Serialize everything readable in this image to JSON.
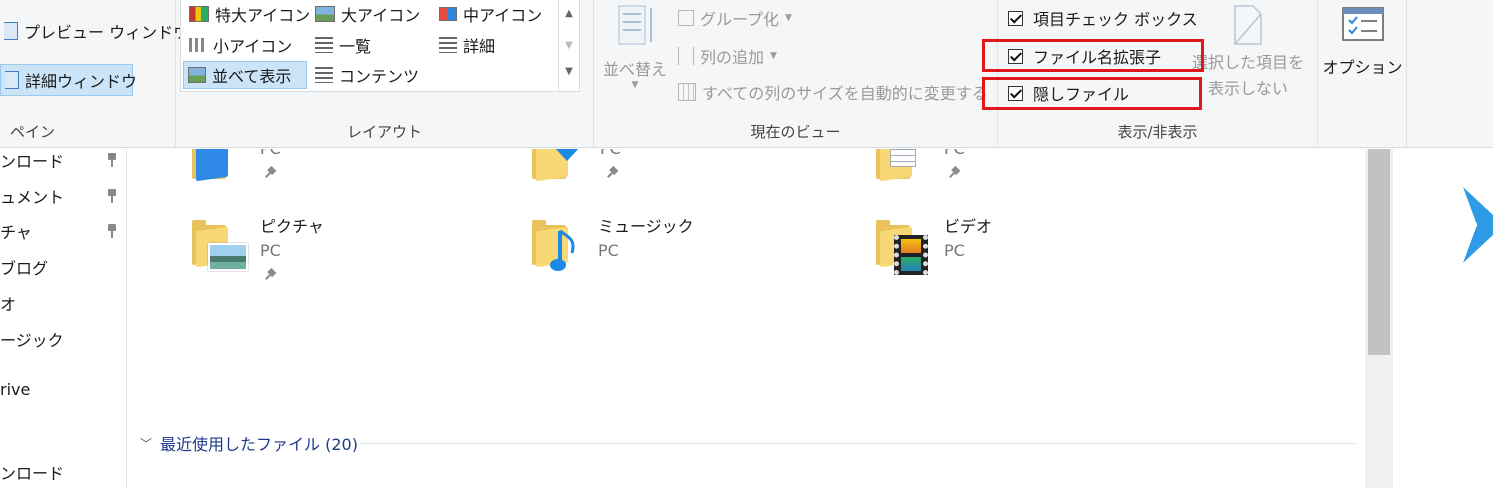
{
  "ribbon": {
    "pane": {
      "label": "ペイン",
      "preview_window": "プレビュー ウィンドウ",
      "details_window": "詳細ウィンドウ"
    },
    "layout": {
      "label": "レイアウト",
      "items": {
        "extra_large": "特大アイコン",
        "large": "大アイコン",
        "medium": "中アイコン",
        "small": "小アイコン",
        "list": "一覧",
        "details": "詳細",
        "tiles": "並べて表示",
        "content": "コンテンツ"
      },
      "selected": "並べて表示"
    },
    "current_view": {
      "label": "現在のビュー",
      "sort": "並べ替え",
      "group_by": "グループ化",
      "add_columns": "列の追加",
      "size_all_columns": "すべての列のサイズを自動的に変更する"
    },
    "show_hide": {
      "label": "表示/非表示",
      "item_checkboxes": "項目チェック ボックス",
      "file_extensions": "ファイル名拡張子",
      "hidden_items": "隠しファイル",
      "hide_selected_line1": "選択した項目を",
      "hide_selected_line2": "表示しない"
    },
    "options": {
      "label": "オプション"
    }
  },
  "nav": {
    "items": [
      "ンロード",
      "ュメント",
      "チャ",
      "ブログ",
      "オ",
      "ージック",
      "rive",
      "ンロード"
    ]
  },
  "content": {
    "top_row_sub": [
      "PC",
      "PC",
      "PC"
    ],
    "folders": [
      {
        "name": "ピクチャ",
        "sub": "PC"
      },
      {
        "name": "ミュージック",
        "sub": "PC"
      },
      {
        "name": "ビデオ",
        "sub": "PC"
      }
    ],
    "recent_header": "最近使用したファイル (20)"
  },
  "colors": {
    "highlight_box": "#e0181b",
    "selected_bg": "#cce4f7",
    "section_header": "#1e3a8a"
  }
}
